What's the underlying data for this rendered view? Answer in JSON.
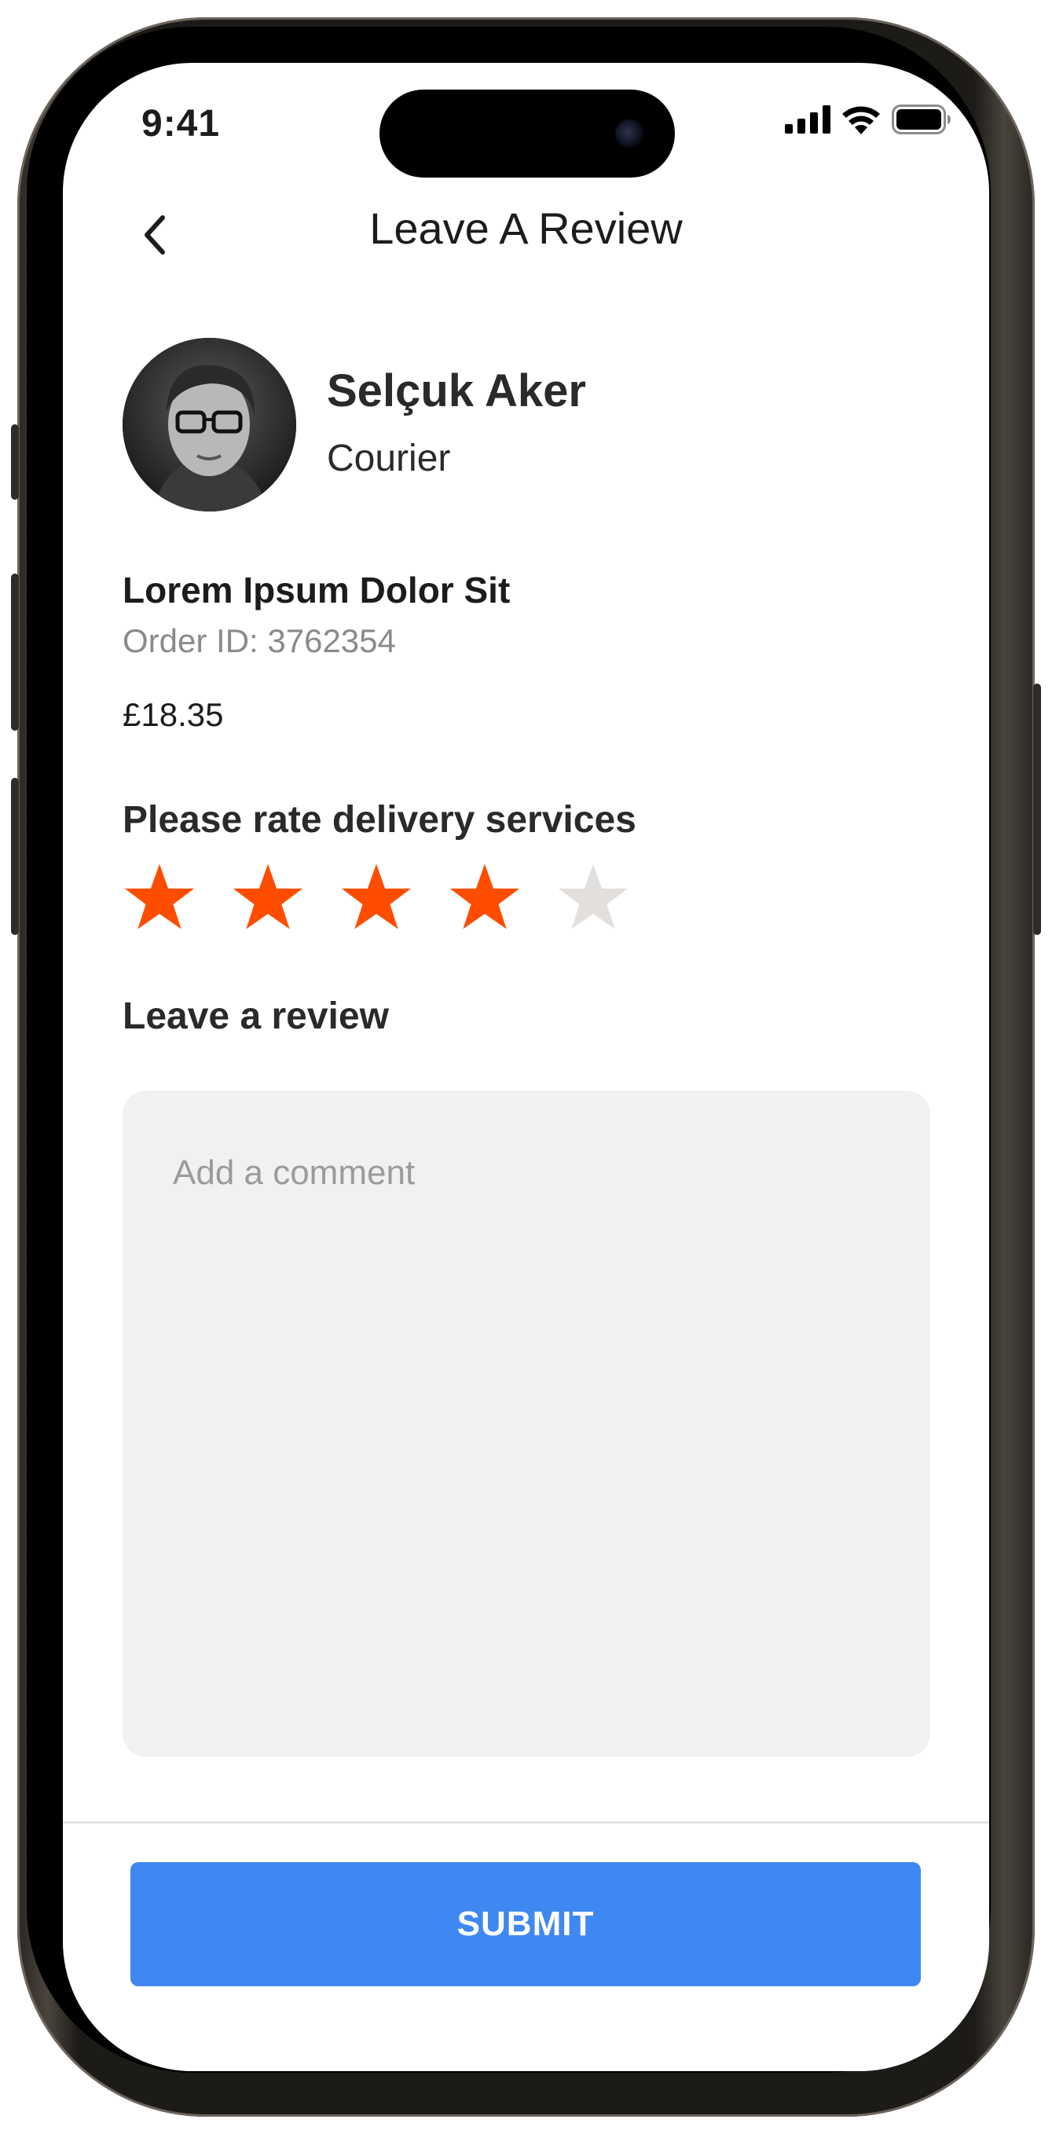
{
  "status_bar": {
    "time": "9:41",
    "icons": [
      "cellular-signal-icon",
      "wifi-icon",
      "battery-icon"
    ]
  },
  "header": {
    "title": "Leave A Review",
    "back_icon": "chevron-left-icon"
  },
  "courier": {
    "name": "Selçuk Aker",
    "role": "Courier",
    "avatar_icon": "avatar-photo"
  },
  "order": {
    "title": "Lorem Ipsum Dolor Sit",
    "order_id": "Order ID: 3762354",
    "price": "£18.35"
  },
  "rating": {
    "label": "Please rate delivery services",
    "value": 4,
    "max": 5,
    "active_color": "#ff4d00",
    "inactive_color": "#e2dfdd"
  },
  "review": {
    "label": "Leave a review",
    "placeholder": "Add a comment",
    "value": ""
  },
  "submit": {
    "label": "SUBMIT",
    "color": "#3f88f2"
  }
}
